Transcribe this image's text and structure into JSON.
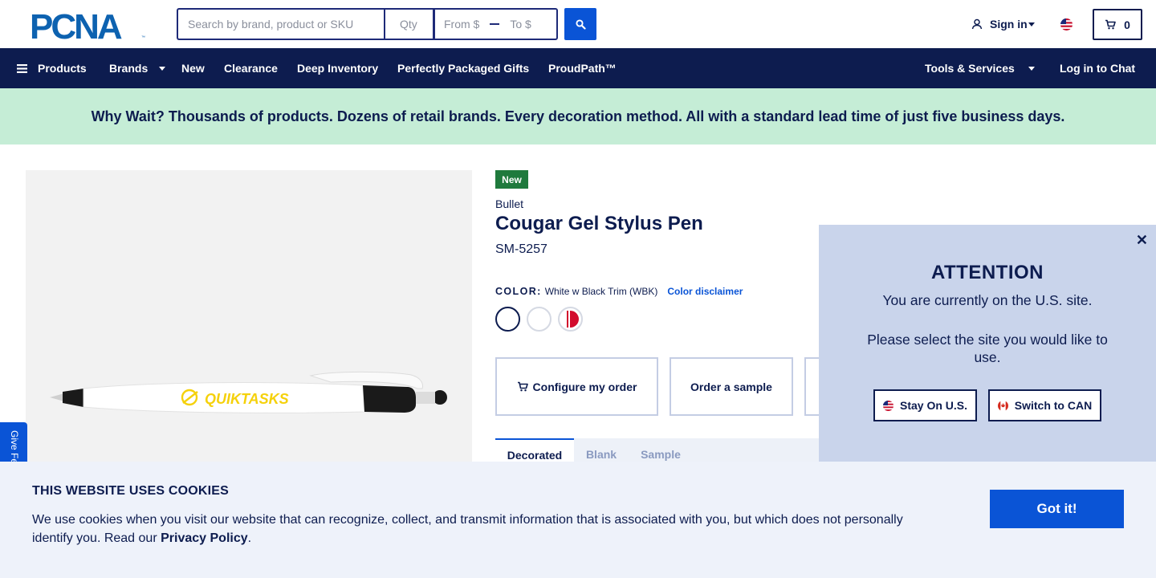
{
  "header": {
    "search_placeholder": "Search by brand, product or SKU",
    "qty_placeholder": "Qty",
    "from_placeholder": "From $",
    "to_placeholder": "To $",
    "sign_in_label": "Sign in",
    "cart_count": "0"
  },
  "nav": {
    "products": "Products",
    "brands": "Brands",
    "new": "New",
    "clearance": "Clearance",
    "deep_inventory": "Deep Inventory",
    "perfectly_packaged_gifts": "Perfectly Packaged Gifts",
    "proudpath": "ProudPath™",
    "tools_services": "Tools & Services",
    "log_in_chat": "Log in to Chat"
  },
  "promo": {
    "text": "Why Wait? Thousands of products. Dozens of retail brands. Every decoration method. All with a standard lead time of just five business days."
  },
  "product": {
    "badge": "New",
    "brand": "Bullet",
    "title": "Cougar Gel Stylus Pen",
    "sku": "SM-5257",
    "color_label": "COLOR:",
    "color_value": "White w Black Trim (WBK)",
    "color_disclaimer": "Color disclaimer",
    "imprint_text": "QUIKTASKS",
    "configure_label": "Configure my order",
    "sample_label": "Order a sample",
    "tabs": [
      "Decorated",
      "Blank",
      "Sample"
    ]
  },
  "attention": {
    "title": "ATTENTION",
    "line1": "You are currently on the U.S. site.",
    "line2": "Please select the site you would like to use.",
    "stay_label": "Stay On U.S.",
    "switch_label": "Switch to CAN"
  },
  "cookie": {
    "title": "THIS WEBSITE USES COOKIES",
    "text": "We use cookies when you visit our website that can recognize, collect, and transmit information that is associated with you, but which does not personally identify you. Read our",
    "link": "Privacy Policy",
    "period": ".",
    "button": "Got it!"
  },
  "feedback": {
    "label": "Give Feedback"
  },
  "colors": {
    "navy": "#0d1c4f",
    "accent_blue": "#0a54d6",
    "promo_green": "#c5edd6",
    "badge_green": "#1f7a3d"
  }
}
